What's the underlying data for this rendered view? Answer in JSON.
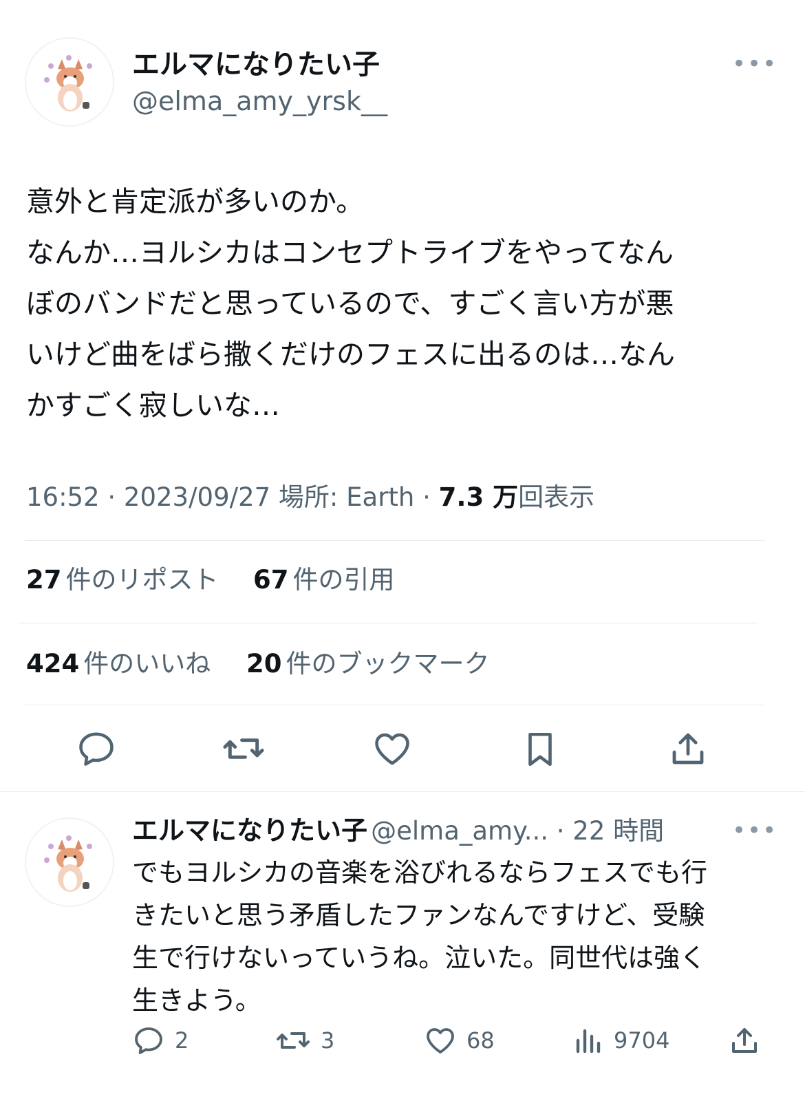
{
  "tweet": {
    "author_name": "エルマになりたい子",
    "author_handle": "@elma_amy_yrsk__",
    "more_icon": "more-icon",
    "text_lines": [
      "意外と肯定派が多いのか。",
      "なんか…ヨルシカはコンセプトライブをやってなん",
      "ぼのバンドだと思っているので、すごく言い方が悪",
      "いけど曲をばら撒くだけのフェスに出るのは…なん",
      "かすごく寂しいな…"
    ],
    "timestamp": "16:52 · 2023/09/27 場所: Earth · ",
    "views_count": "7.3 万",
    "views_label": "回表示",
    "reposts_count": "27",
    "reposts_label": "件のリポスト",
    "quotes_count": "67",
    "quotes_label": "件の引用",
    "likes_count": "424",
    "likes_label": "件のいいね",
    "bookmarks_count": "20",
    "bookmarks_label": "件のブックマーク",
    "actions": [
      "reply-icon",
      "repost-icon",
      "like-icon",
      "bookmark-icon",
      "share-icon"
    ]
  },
  "reply": {
    "author_name": "エルマになりたい子",
    "author_handle": "@elma_amy...",
    "time": " · 22 時間",
    "text_lines": [
      "でもヨルシカの音楽を浴びれるならフェスでも行",
      "きたいと思う矛盾したファンなんですけど、受験",
      "生で行けないっていうね。泣いた。同世代は強く",
      "生きよう。"
    ],
    "reply_count": "2",
    "repost_count": "3",
    "like_count": "68",
    "view_count": "9704"
  },
  "colors": {
    "text": "#0f1419",
    "secondary": "#536471",
    "divider": "#e6ecf0",
    "icon": "#536471"
  }
}
